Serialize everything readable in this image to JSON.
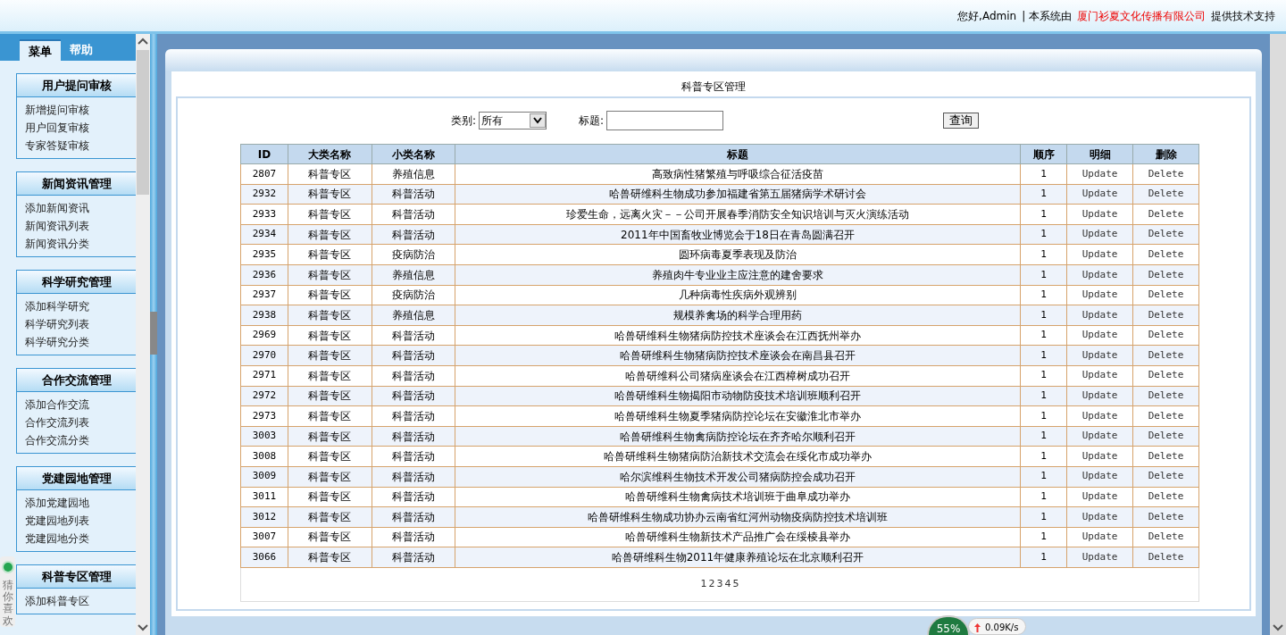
{
  "header": {
    "greeting": "您好,Admin",
    "support_prefix": "| 本系统由",
    "company": "厦门衫夏文化传播有限公司",
    "support_suffix": "提供技术支持"
  },
  "sidebar": {
    "tabs": [
      {
        "label": "菜单",
        "selected": true
      },
      {
        "label": "帮助",
        "selected": false
      }
    ],
    "groups": [
      {
        "title": "用户提问审核",
        "items": [
          "新增提问审核",
          "用户回复审核",
          "专家答疑审核"
        ]
      },
      {
        "title": "新闻资讯管理",
        "items": [
          "添加新闻资讯",
          "新闻资讯列表",
          "新闻资讯分类"
        ]
      },
      {
        "title": "科学研究管理",
        "items": [
          "添加科学研究",
          "科学研究列表",
          "科学研究分类"
        ]
      },
      {
        "title": "合作交流管理",
        "items": [
          "添加合作交流",
          "合作交流列表",
          "合作交流分类"
        ]
      },
      {
        "title": "党建园地管理",
        "items": [
          "添加党建园地",
          "党建园地列表",
          "党建园地分类"
        ]
      },
      {
        "title": "科普专区管理",
        "items": [
          "添加科普专区"
        ]
      }
    ]
  },
  "page_title": "科普专区管理",
  "filter": {
    "category_label": "类别:",
    "category_value": "所有",
    "title_label": "标题:",
    "search_button": "查询"
  },
  "table": {
    "columns": [
      "ID",
      "大类名称",
      "小类名称",
      "标题",
      "顺序",
      "明细",
      "删除"
    ],
    "rows": [
      {
        "id": "2807",
        "category": "科普专区",
        "subcategory": "养殖信息",
        "title": "高致病性猪繁殖与呼吸综合征活疫苗",
        "order": "1",
        "detail": "Update",
        "delete": "Delete"
      },
      {
        "id": "2932",
        "category": "科普专区",
        "subcategory": "科普活动",
        "title": "哈兽研维科生物成功参加福建省第五届猪病学术研讨会",
        "order": "1",
        "detail": "Update",
        "delete": "Delete"
      },
      {
        "id": "2933",
        "category": "科普专区",
        "subcategory": "科普活动",
        "title": "珍爱生命，远离火灾－－公司开展春季消防安全知识培训与灭火演练活动",
        "order": "1",
        "detail": "Update",
        "delete": "Delete"
      },
      {
        "id": "2934",
        "category": "科普专区",
        "subcategory": "科普活动",
        "title": "2011年中国畜牧业博览会于18日在青岛圆满召开",
        "order": "1",
        "detail": "Update",
        "delete": "Delete"
      },
      {
        "id": "2935",
        "category": "科普专区",
        "subcategory": "疫病防治",
        "title": "圆环病毒夏季表现及防治",
        "order": "1",
        "detail": "Update",
        "delete": "Delete"
      },
      {
        "id": "2936",
        "category": "科普专区",
        "subcategory": "养殖信息",
        "title": "养殖肉牛专业业主应注意的建舍要求",
        "order": "1",
        "detail": "Update",
        "delete": "Delete"
      },
      {
        "id": "2937",
        "category": "科普专区",
        "subcategory": "疫病防治",
        "title": "几种病毒性疾病外观辨别",
        "order": "1",
        "detail": "Update",
        "delete": "Delete"
      },
      {
        "id": "2938",
        "category": "科普专区",
        "subcategory": "养殖信息",
        "title": "规模养禽场的科学合理用药",
        "order": "1",
        "detail": "Update",
        "delete": "Delete"
      },
      {
        "id": "2969",
        "category": "科普专区",
        "subcategory": "科普活动",
        "title": "哈兽研维科生物猪病防控技术座谈会在江西抚州举办",
        "order": "1",
        "detail": "Update",
        "delete": "Delete"
      },
      {
        "id": "2970",
        "category": "科普专区",
        "subcategory": "科普活动",
        "title": "哈兽研维科生物猪病防控技术座谈会在南昌县召开",
        "order": "1",
        "detail": "Update",
        "delete": "Delete"
      },
      {
        "id": "2971",
        "category": "科普专区",
        "subcategory": "科普活动",
        "title": "哈兽研维科公司猪病座谈会在江西樟树成功召开",
        "order": "1",
        "detail": "Update",
        "delete": "Delete"
      },
      {
        "id": "2972",
        "category": "科普专区",
        "subcategory": "科普活动",
        "title": "哈兽研维科生物揭阳市动物防疫技术培训班顺利召开",
        "order": "1",
        "detail": "Update",
        "delete": "Delete"
      },
      {
        "id": "2973",
        "category": "科普专区",
        "subcategory": "科普活动",
        "title": "哈兽研维科生物夏季猪病防控论坛在安徽淮北市举办",
        "order": "1",
        "detail": "Update",
        "delete": "Delete"
      },
      {
        "id": "3003",
        "category": "科普专区",
        "subcategory": "科普活动",
        "title": "哈兽研维科生物禽病防控论坛在齐齐哈尔顺利召开",
        "order": "1",
        "detail": "Update",
        "delete": "Delete"
      },
      {
        "id": "3008",
        "category": "科普专区",
        "subcategory": "科普活动",
        "title": "哈兽研维科生物猪病防治新技术交流会在绥化市成功举办",
        "order": "1",
        "detail": "Update",
        "delete": "Delete"
      },
      {
        "id": "3009",
        "category": "科普专区",
        "subcategory": "科普活动",
        "title": "哈尔滨维科生物技术开发公司猪病防控会成功召开",
        "order": "1",
        "detail": "Update",
        "delete": "Delete"
      },
      {
        "id": "3011",
        "category": "科普专区",
        "subcategory": "科普活动",
        "title": "哈兽研维科生物禽病技术培训班于曲阜成功举办",
        "order": "1",
        "detail": "Update",
        "delete": "Delete"
      },
      {
        "id": "3012",
        "category": "科普专区",
        "subcategory": "科普活动",
        "title": "哈兽研维科生物成功协办云南省红河州动物疫病防控技术培训班",
        "order": "1",
        "detail": "Update",
        "delete": "Delete"
      },
      {
        "id": "3007",
        "category": "科普专区",
        "subcategory": "科普活动",
        "title": "哈兽研维科生物新技术产品推广会在绥棱县举办",
        "order": "1",
        "detail": "Update",
        "delete": "Delete"
      },
      {
        "id": "3066",
        "category": "科普专区",
        "subcategory": "科普活动",
        "title": "哈兽研维科生物2011年健康养殖论坛在北京顺利召开",
        "order": "1",
        "detail": "Update",
        "delete": "Delete"
      }
    ]
  },
  "pagination": [
    "1",
    "2",
    "3",
    "4",
    "5"
  ],
  "widgets": {
    "recommend": "猜你喜欢",
    "meter": "55%",
    "speed": "0.09K/s"
  }
}
